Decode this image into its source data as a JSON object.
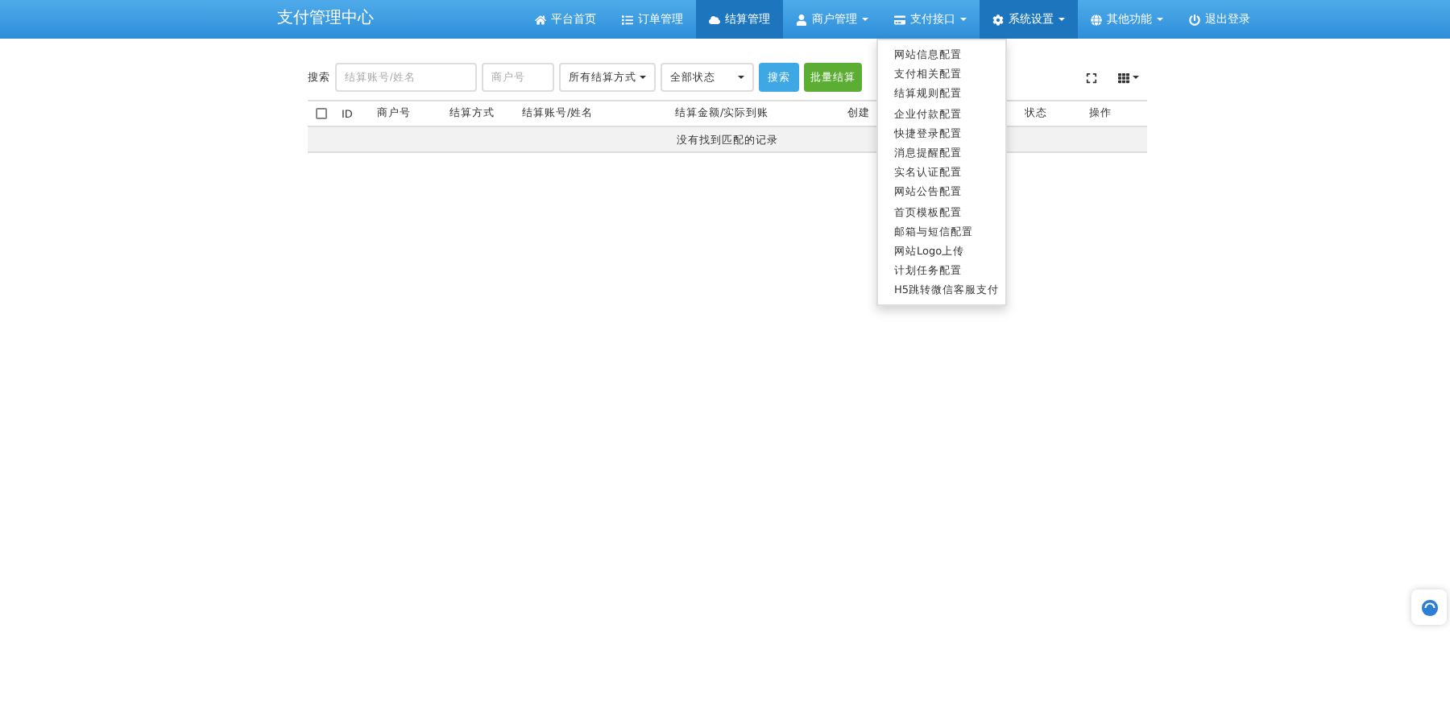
{
  "navbar": {
    "brand": "支付管理中心",
    "items": [
      {
        "label": "平台首页",
        "dropdown": false,
        "selected": false
      },
      {
        "label": "订单管理",
        "dropdown": false,
        "selected": false
      },
      {
        "label": "结算管理",
        "dropdown": false,
        "selected": true
      },
      {
        "label": "商户管理",
        "dropdown": true,
        "selected": false
      },
      {
        "label": "支付接口",
        "dropdown": true,
        "selected": false
      },
      {
        "label": "系统设置",
        "dropdown": true,
        "selected": true
      },
      {
        "label": "其他功能",
        "dropdown": true,
        "selected": false
      },
      {
        "label": "退出登录",
        "dropdown": false,
        "selected": false
      }
    ]
  },
  "dropdown_menu": {
    "items": [
      "网站信息配置",
      "支付相关配置",
      "结算规则配置",
      "企业付款配置",
      "快捷登录配置",
      "消息提醒配置",
      "实名认证配置",
      "网站公告配置",
      "首页模板配置",
      "邮箱与短信配置",
      "网站Logo上传",
      "计划任务配置",
      "H5跳转微信客服支付"
    ]
  },
  "search": {
    "label": "搜索",
    "account": {
      "placeholder": "结算账号/姓名"
    },
    "merchant": {
      "placeholder": "商户号"
    },
    "method": {
      "value": "所有结算方式"
    },
    "status": {
      "value": "全部状态"
    },
    "buttons": [
      "搜索",
      "批量结算"
    ]
  },
  "table": {
    "select_all": {
      "checked": false
    },
    "columns": [
      "ID",
      "商户号",
      "结算方式",
      "结算账号/姓名",
      "结算金额/实际到账",
      "创建",
      "状态",
      "操作"
    ],
    "empty": "没有找到匹配的记录"
  }
}
